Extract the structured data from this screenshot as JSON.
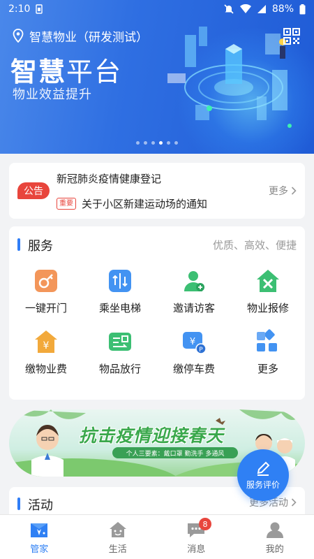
{
  "status_bar": {
    "time": "2:10",
    "battery": "88%"
  },
  "header": {
    "location": "智慧物业（研发测试）",
    "title_bold": "智慧",
    "title_light": "平台",
    "subtitle": "物业效益提升",
    "carousel": {
      "count": 6,
      "active_index": 3
    }
  },
  "notice": {
    "tag": "公告",
    "line1": "新冠肺炎疫情健康登记",
    "badge": "重要",
    "line2": "关于小区新建运动场的通知",
    "more": "更多"
  },
  "services": {
    "title": "服务",
    "aside": "优质、高效、便捷",
    "items": [
      {
        "label": "一键开门",
        "icon": "door-key-icon",
        "color": "#f08a4b"
      },
      {
        "label": "乘坐电梯",
        "icon": "elevator-icon",
        "color": "#3d8ef0"
      },
      {
        "label": "邀请访客",
        "icon": "add-visitor-icon",
        "color": "#3cbf73"
      },
      {
        "label": "物业报修",
        "icon": "repair-icon",
        "color": "#3cbf73"
      },
      {
        "label": "缴物业费",
        "icon": "property-fee-icon",
        "color": "#f2a93b"
      },
      {
        "label": "物品放行",
        "icon": "goods-release-icon",
        "color": "#3cbf73"
      },
      {
        "label": "缴停车费",
        "icon": "parking-fee-icon",
        "color": "#3d8ef0"
      },
      {
        "label": "更多",
        "icon": "more-grid-icon",
        "color": "#3d8ef0"
      }
    ]
  },
  "promo": {
    "title": "抗击疫情迎接春天",
    "pill": "个人三要素：戴口罩 勤洗手 多通风"
  },
  "fab": {
    "label": "服务评价"
  },
  "activity": {
    "title": "活动",
    "more": "更多活动"
  },
  "tabbar": {
    "tabs": [
      {
        "label": "管家",
        "icon": "butler-icon",
        "active": true
      },
      {
        "label": "生活",
        "icon": "life-icon",
        "active": false
      },
      {
        "label": "消息",
        "icon": "message-icon",
        "active": false,
        "badge": "8"
      },
      {
        "label": "我的",
        "icon": "profile-icon",
        "active": false
      }
    ]
  },
  "colors": {
    "primary": "#2f80f4",
    "alert": "#e8453c",
    "page_bg": "#f2f3f5"
  }
}
